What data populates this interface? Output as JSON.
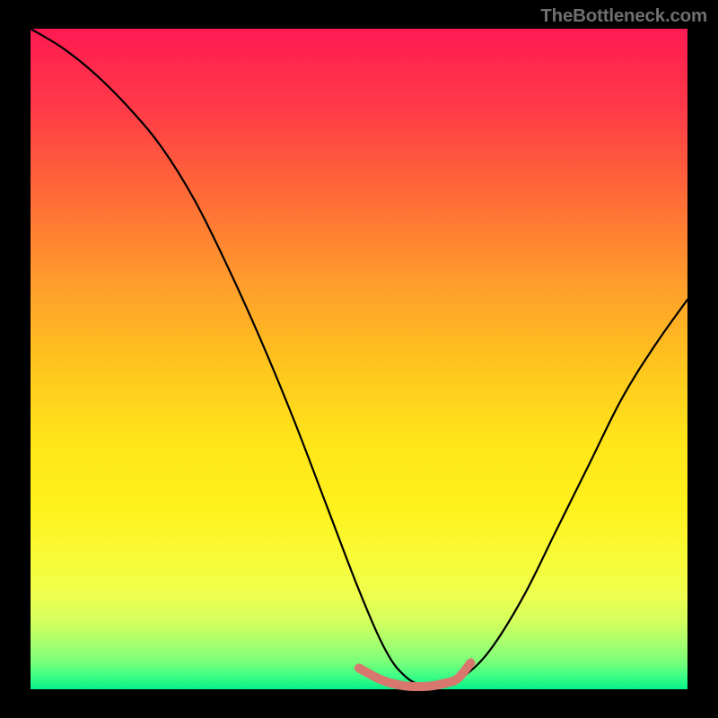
{
  "watermark": "TheBottleneck.com",
  "colors": {
    "background": "#000000",
    "gradient": [
      "#ff1a52",
      "#ff3a48",
      "#ff6a37",
      "#ff9b2c",
      "#ffc21f",
      "#ffe41a",
      "#fff11c",
      "#f8fa36",
      "#edff4f",
      "#d0ff5e",
      "#a7ff6e",
      "#77ff79",
      "#3eff86",
      "#07ef8a"
    ],
    "curve_stroke": "#000000",
    "accent_stroke": "#d8776d"
  },
  "chart_data": {
    "type": "line",
    "title": "",
    "xlabel": "",
    "ylabel": "",
    "xlim": [
      0,
      100
    ],
    "ylim": [
      0,
      100
    ],
    "series": [
      {
        "name": "main-curve",
        "x": [
          0,
          5,
          10,
          15,
          20,
          25,
          30,
          35,
          40,
          45,
          50,
          54,
          57,
          60,
          63,
          66,
          70,
          75,
          80,
          85,
          90,
          95,
          100
        ],
        "y": [
          100,
          97,
          93,
          88,
          82,
          74,
          64,
          53,
          41,
          28,
          15,
          6,
          2,
          0.5,
          0.5,
          2,
          6,
          14,
          24,
          34,
          44,
          52,
          59
        ]
      },
      {
        "name": "accent-bottom",
        "x": [
          50,
          53,
          55,
          57,
          59,
          61,
          63,
          65,
          67
        ],
        "y": [
          3.2,
          1.6,
          0.9,
          0.5,
          0.4,
          0.5,
          0.9,
          1.6,
          4.0
        ]
      }
    ]
  }
}
